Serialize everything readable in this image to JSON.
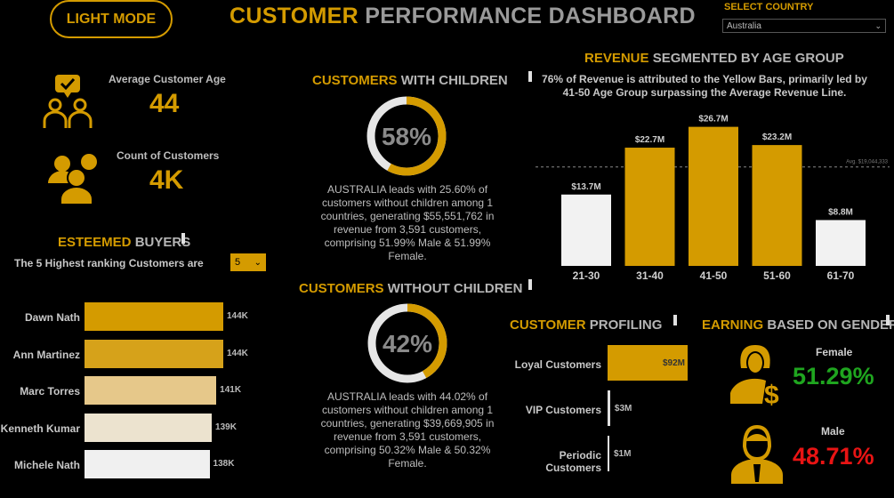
{
  "header": {
    "mode_button": "LIGHT MODE",
    "title_part1": "CUSTOMER",
    "title_part2": "PERFORMANCE DASHBOARD",
    "select_label": "SELECT COUNTRY",
    "select_value": "Australia"
  },
  "kpis": {
    "avg_age_label": "Average Customer Age",
    "avg_age_value": "44",
    "count_label": "Count of Customers",
    "count_value": "4K"
  },
  "esteemed": {
    "title_part1": "ESTEEMED",
    "title_part2": "BUYERS",
    "subtitle": "The 5 Highest ranking Customers are",
    "stepper_value": "5",
    "chart_data": {
      "type": "bar",
      "orientation": "horizontal",
      "categories": [
        "Dawn Nath",
        "Ann Martinez",
        "Marc Torres",
        "Kenneth Kumar",
        "Michele Nath"
      ],
      "values": [
        144,
        144,
        141,
        139,
        138
      ],
      "labels": [
        "144K",
        "144K",
        "141K",
        "139K",
        "138K"
      ],
      "colors": [
        "#d49b00",
        "#d6a21a",
        "#e6c88a",
        "#ece3cf",
        "#f0f0f0"
      ]
    }
  },
  "with_children": {
    "title_part1": "CUSTOMERS",
    "title_part2": "WITH CHILDREN",
    "percent": 58,
    "percent_label": "58%",
    "text": "AUSTRALIA leads with 25.60% of customers without children among 1 countries, generating $55,551,762 in revenue from 3,591 customers, comprising 51.99% Male & 51.99% Female."
  },
  "without_children": {
    "title_part1": "CUSTOMERS",
    "title_part2": "WITHOUT CHILDREN",
    "percent": 42,
    "percent_label": "42%",
    "text": "AUSTRALIA leads with 44.02% of customers without children among 1 countries, generating $39,669,905 in revenue from 3,591 customers, comprising 50.32% Male & 50.32% Female."
  },
  "revenue": {
    "title_part1": "REVENUE",
    "title_part2": "SEGMENTED BY AGE GROUP",
    "note": "76% of Revenue is attributed to the Yellow Bars, primarily led by 41-50 Age Group surpassing the Average Revenue Line.",
    "chart_data": {
      "type": "bar",
      "categories": [
        "21-30",
        "31-40",
        "41-50",
        "51-60",
        "61-70"
      ],
      "values": [
        13.7,
        22.7,
        26.7,
        23.2,
        8.8
      ],
      "labels": [
        "$13.7M",
        "$22.7M",
        "$26.7M",
        "$23.2M",
        "$8.8M"
      ],
      "highlight": [
        false,
        true,
        true,
        true,
        false
      ],
      "avg_line": 19.0,
      "avg_label": "Avg. $19,044,333",
      "ylim": [
        0,
        28
      ]
    }
  },
  "profiling": {
    "title_part1": "CUSTOMER",
    "title_part2": "PROFILING",
    "chart_data": {
      "type": "bar",
      "orientation": "horizontal",
      "categories": [
        "Loyal Customers",
        "VIP Customers",
        "Periodic Customers"
      ],
      "values": [
        92,
        3,
        1
      ],
      "labels": [
        "$92M",
        "$3M",
        "$1M"
      ]
    }
  },
  "gender": {
    "title_part1": "EARNING",
    "title_part2": "BASED ON GENDER",
    "female_label": "Female",
    "female_value": "51.29%",
    "male_label": "Male",
    "male_value": "48.71%",
    "colors": {
      "female": "#1fa51f",
      "male": "#e81414"
    }
  },
  "colors": {
    "accent": "#d49b00",
    "background": "#000000"
  }
}
